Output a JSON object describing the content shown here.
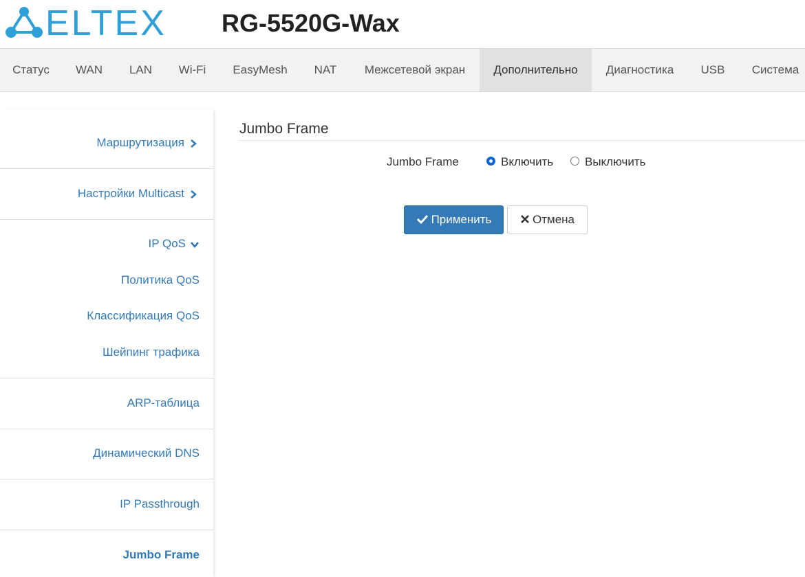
{
  "brand": {
    "logo_text": "ELTEX",
    "model": "RG-5520G-Wax"
  },
  "topnav": {
    "items": [
      "Статус",
      "WAN",
      "LAN",
      "Wi-Fi",
      "EasyMesh",
      "NAT",
      "Межсетевой экран",
      "Дополнительно",
      "Диагностика",
      "USB",
      "Система"
    ],
    "active": "Дополнительно"
  },
  "sidebar": {
    "routing": "Маршрутизация",
    "multicast": "Настройки Multicast",
    "ipqos": "IP QoS",
    "qos_policy": "Политика QoS",
    "qos_classification": "Классификация QoS",
    "traffic_shaping": "Шейпинг трафика",
    "arp_table": "ARP-таблица",
    "dynamic_dns": "Динамический DNS",
    "ip_passthrough": "IP Passthrough",
    "jumbo_frame": "Jumbo Frame",
    "selected": "Jumbo Frame"
  },
  "main": {
    "title": "Jumbo Frame",
    "field_label": "Jumbo Frame",
    "radio_on": "Включить",
    "radio_off": "Выключить",
    "selected_option": "Включить",
    "apply_button": "Применить",
    "cancel_button": "Отмена"
  },
  "colors": {
    "brand": "#2f9fd8",
    "link": "#337ab7",
    "primary": "#337ab7",
    "nav_bg": "#f2f2f2",
    "nav_active_bg": "#e1e1e1"
  }
}
